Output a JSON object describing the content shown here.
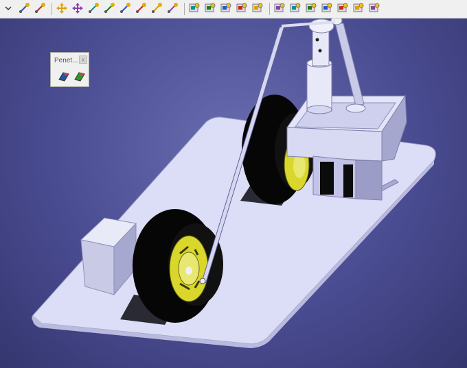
{
  "toolbar": {
    "groups": [
      [
        "dropdown-arrow-icon",
        "paint-brush-icon",
        "material-icon"
      ],
      [
        "fly-icon",
        "pan-icon",
        "snap-icon",
        "compass-icon",
        "measure-between-icon",
        "measure-item-icon",
        "inertia-icon",
        "clash-icon"
      ],
      [
        "analysis-1-icon",
        "analysis-2-icon",
        "analysis-3-icon",
        "analysis-4-icon",
        "analysis-5-icon"
      ],
      [
        "constraint-1-icon",
        "constraint-2-icon",
        "constraint-3-icon",
        "constraint-4-icon",
        "constraint-5-icon",
        "constraint-6-icon",
        "constraint-7-icon"
      ]
    ]
  },
  "panel": {
    "title": "Penet...",
    "close_label": "x",
    "tools": [
      "penetration-section-icon",
      "penetration-analysis-icon"
    ]
  },
  "colors": {
    "background": "#4a4c92",
    "plate": "#d9daf5",
    "tire": "#0a0a0a",
    "rim": "#d7d52a",
    "metal": "#d4d6ee"
  }
}
